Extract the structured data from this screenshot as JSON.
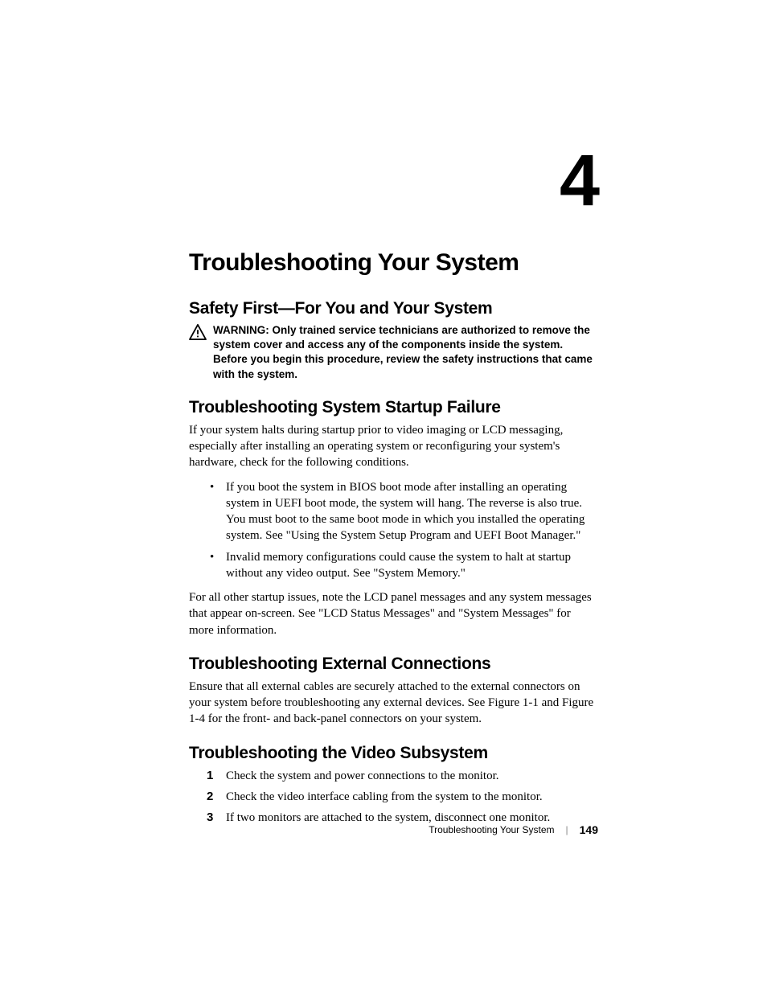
{
  "chapter_number": "4",
  "title": "Troubleshooting Your System",
  "sections": {
    "safety": {
      "heading": "Safety First—For You and Your System",
      "warning_label": "WARNING: ",
      "warning_text": "Only trained service technicians are authorized to remove the system cover and access any of the components inside the system. Before you begin this procedure, review the safety instructions that came with the system."
    },
    "startup": {
      "heading": "Troubleshooting System Startup Failure",
      "intro": "If your system halts during startup prior to video imaging or LCD messaging, especially after installing an operating system or reconfiguring your system's hardware, check for the following conditions.",
      "bullets": [
        "If you boot the system in BIOS boot mode after installing an operating system in UEFI boot mode, the system will hang. The reverse is also true. You must boot to the same boot mode in which you installed the operating system. See \"Using the System Setup Program and UEFI Boot Manager.\"",
        "Invalid memory configurations could cause the system to halt at startup without any video output. See \"System Memory.\""
      ],
      "outro": "For all other startup issues, note the LCD panel messages and any system messages that appear on-screen. See \"LCD Status Messages\" and \"System Messages\" for more information."
    },
    "external": {
      "heading": "Troubleshooting External Connections",
      "body": "Ensure that all external cables are securely attached to the external connectors on your system before troubleshooting any external devices. See Figure 1-1 and Figure 1-4 for the front- and back-panel connectors on your system."
    },
    "video": {
      "heading": "Troubleshooting the Video Subsystem",
      "steps": [
        "Check the system and power connections to the monitor.",
        "Check the video interface cabling from the system to the monitor.",
        "If two monitors are attached to the system, disconnect one monitor."
      ]
    }
  },
  "footer": {
    "section": "Troubleshooting Your System",
    "page": "149"
  }
}
